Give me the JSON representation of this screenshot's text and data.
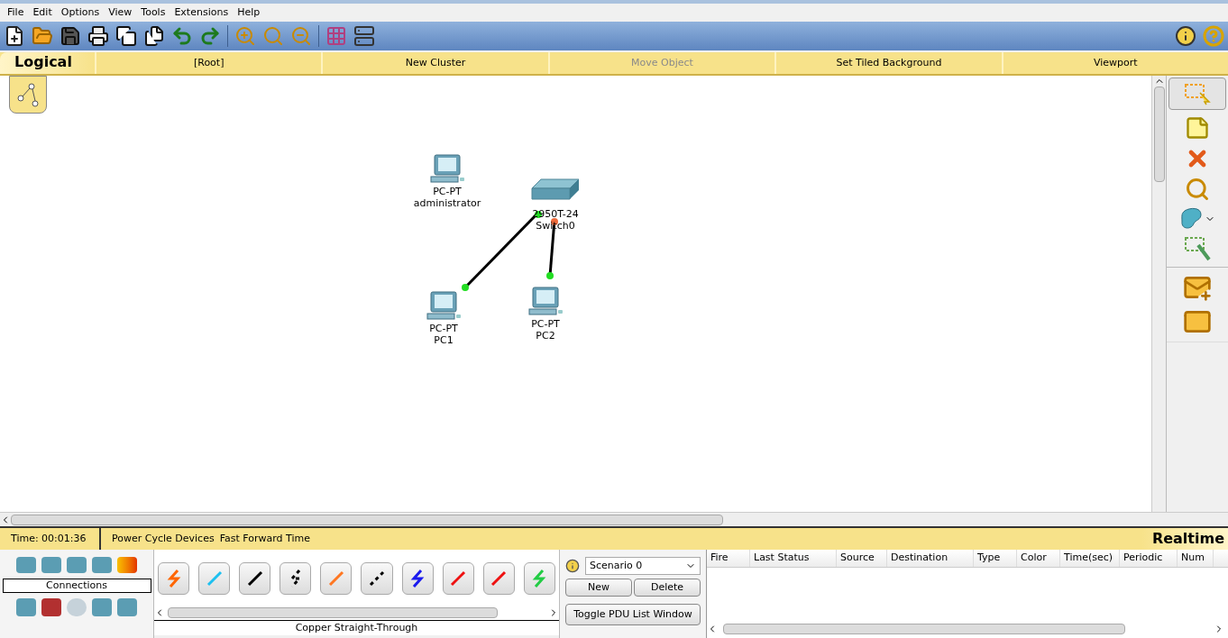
{
  "menu": [
    "File",
    "Edit",
    "Options",
    "View",
    "Tools",
    "Extensions",
    "Help"
  ],
  "workspace_bar": {
    "mode": "Logical",
    "items": [
      {
        "label": "[Root]",
        "disabled": false
      },
      {
        "label": "New Cluster",
        "disabled": false
      },
      {
        "label": "Move Object",
        "disabled": true
      },
      {
        "label": "Set Tiled Background",
        "disabled": false
      },
      {
        "label": "Viewport",
        "disabled": false
      }
    ]
  },
  "devices": [
    {
      "model": "PC-PT",
      "name": "administrator",
      "kind": "pc"
    },
    {
      "model": "2950T-24",
      "name": "Switch0",
      "kind": "switch"
    },
    {
      "model": "PC-PT",
      "name": "PC1",
      "kind": "pc"
    },
    {
      "model": "PC-PT",
      "name": "PC2",
      "kind": "pc"
    }
  ],
  "links": [
    {
      "ends": [
        {
          "color": "#22dd22"
        },
        {
          "color": "#22dd22"
        }
      ]
    },
    {
      "ends": [
        {
          "color": "#ee6a3a"
        },
        {
          "color": "#22dd22"
        }
      ]
    }
  ],
  "status_bar": {
    "time": "Time: 00:01:36",
    "buttons": [
      "Power Cycle Devices",
      "Fast Forward Time"
    ],
    "mode": "Realtime"
  },
  "device_panel": {
    "category": "Connections",
    "selected_type": "Copper Straight-Through"
  },
  "scenario": {
    "value": "Scenario 0",
    "buttons": [
      "New",
      "Delete"
    ],
    "toggle": "Toggle PDU List Window"
  },
  "pdu_table": {
    "columns": [
      "Fire",
      "Last Status",
      "Source",
      "Destination",
      "Type",
      "Color",
      "Time(sec)",
      "Periodic",
      "Num"
    ]
  }
}
